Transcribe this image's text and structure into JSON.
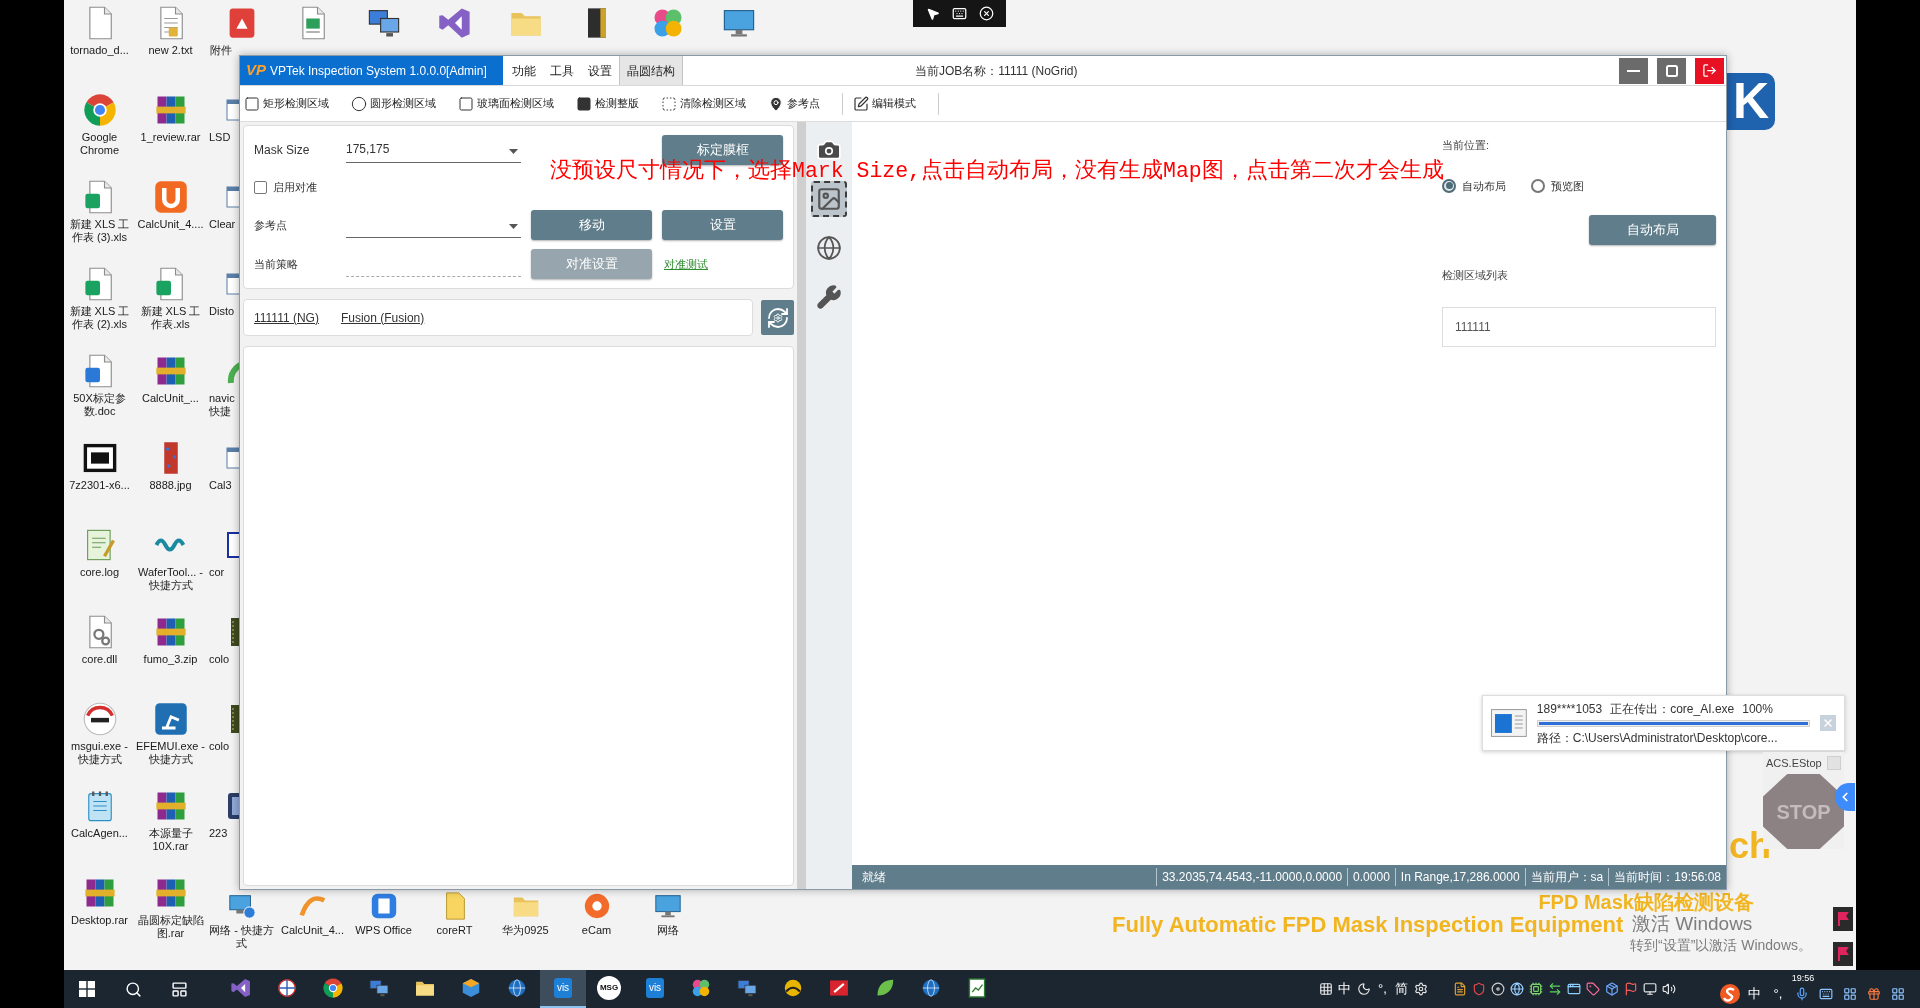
{
  "desktop": {
    "columns": [
      [
        {
          "label": "tornado_d...",
          "kind": "blank"
        },
        {
          "label": "Google Chrome",
          "kind": "browser"
        },
        {
          "label": "新建 XLS 工作表 (3).xls",
          "kind": "sheet"
        },
        {
          "label": "新建 XLS 工作表 (2).xls",
          "kind": "sheet"
        },
        {
          "label": "50X标定参数.doc",
          "kind": "word"
        },
        {
          "label": "7z2301-x6...",
          "kind": "box"
        },
        {
          "label": "core.log",
          "kind": "log"
        },
        {
          "label": "core.dll",
          "kind": "dll"
        },
        {
          "label": "msgui.exe - 快捷方式",
          "kind": "msg"
        },
        {
          "label": "CalcAgen...",
          "kind": "notepad"
        },
        {
          "label": "Desktop.rar",
          "kind": "rar"
        }
      ],
      [
        {
          "label": "new 2.txt",
          "kind": "txt"
        },
        {
          "label": "1_review.rar",
          "kind": "rar"
        },
        {
          "label": "CalcUnit_4....",
          "kind": "ulogo"
        },
        {
          "label": "新建 XLS 工作表.xls",
          "kind": "sheet"
        },
        {
          "label": "CalcUnit_...",
          "kind": "rar"
        },
        {
          "label": "8888.jpg",
          "kind": "image"
        },
        {
          "label": "WaferTool... - 快捷方式",
          "kind": "wave"
        },
        {
          "label": "fumo_3.zip",
          "kind": "rar"
        },
        {
          "label": "EFEMUI.exe - 快捷方式",
          "kind": "robot"
        },
        {
          "label": "本源量子 10X.rar",
          "kind": "rar"
        },
        {
          "label": "晶圆标定缺陷图.rar",
          "kind": "rar"
        }
      ]
    ],
    "top_row": [
      {
        "label": "附件",
        "kind": "pdf"
      },
      {
        "kind": "exe"
      },
      {
        "kind": "computers"
      },
      {
        "kind": "ribbon"
      },
      {
        "kind": "folder"
      },
      {
        "kind": "binder"
      },
      {
        "kind": "petals"
      },
      {
        "kind": "monitor"
      }
    ],
    "partial_column": [
      {
        "label": "LSD",
        "kind": "window"
      },
      {
        "label": "Clear",
        "kind": "window"
      },
      {
        "label": "Disto",
        "kind": "window"
      },
      {
        "label": "navic 快捷",
        "kind": "arc"
      },
      {
        "label": "Cal3",
        "kind": "window"
      },
      {
        "label": "cor",
        "kind": "frame"
      },
      {
        "label": "colo",
        "kind": "film"
      },
      {
        "label": "colo",
        "kind": "film"
      },
      {
        "label": "223",
        "kind": "tablet"
      }
    ],
    "bottom_row": [
      {
        "label": "网络 - 快捷方式",
        "kind": "network"
      },
      {
        "label": "CalcUnit_4...",
        "kind": "swoosh"
      },
      {
        "label": "WPS Office",
        "kind": "wps"
      },
      {
        "label": "coreRT",
        "kind": "file"
      },
      {
        "label": "华为0925",
        "kind": "folder"
      },
      {
        "label": "eCam",
        "kind": "camapp"
      },
      {
        "label": "网络",
        "kind": "monitor"
      }
    ]
  },
  "window": {
    "logo": "VP",
    "title": "VPTek Inspection System 1.0.0.0[Admin]",
    "menu": [
      {
        "label": "功能",
        "selected": false
      },
      {
        "label": "工具",
        "selected": false
      },
      {
        "label": "设置",
        "selected": false
      },
      {
        "label": "晶圆结构",
        "selected": true
      }
    ],
    "job": "当前JOB名称：11111 (NoGrid)"
  },
  "toolbar": [
    {
      "label": "矩形检测区域",
      "kind": "rect"
    },
    {
      "label": "圆形检测区域",
      "kind": "circle"
    },
    {
      "label": "玻璃面检测区域",
      "kind": "glass"
    },
    {
      "label": "检测整版",
      "kind": "full"
    },
    {
      "label": "清除检测区域",
      "kind": "clear"
    },
    {
      "label": "参考点",
      "kind": "pin"
    },
    {
      "label": "编辑模式",
      "kind": "edit"
    }
  ],
  "left_panel": {
    "mask_size": {
      "label": "Mask Size",
      "value": "175,175"
    },
    "calibrate_button": "标定膜框",
    "align": {
      "label": "启用对准",
      "checked": false
    },
    "reference": {
      "label": "参考点"
    },
    "move_button": "移动",
    "set_button": "设置",
    "strategy": {
      "label": "当前策略"
    },
    "align_settings_button": {
      "label": "对准设置",
      "disabled": true
    },
    "align_test_link": "对准测试",
    "job_links": [
      "111111 (NG)",
      "Fusion (Fusion)"
    ]
  },
  "side_tools": [
    {
      "kind": "camera",
      "selected": false
    },
    {
      "kind": "image",
      "selected": true
    },
    {
      "kind": "globe",
      "selected": false
    },
    {
      "kind": "tools",
      "selected": false
    }
  ],
  "right_panel": {
    "position_label": "当前位置:",
    "modes": [
      {
        "label": "自动布局",
        "selected": true
      },
      {
        "label": "预览图",
        "selected": false
      }
    ],
    "auto_layout_button": "自动布局",
    "list_label": "检测区域列表",
    "list_items": [
      "111111"
    ]
  },
  "status_bar": {
    "state": "就绪",
    "fields": [
      "33.2035,74.4543,-11.0000,0.0000",
      "0.0000",
      "In Range,17,286.0000",
      "当前用户：sa",
      "当前时间：19:56:08"
    ]
  },
  "annotation": [
    {
      "text": "没预设尺寸情况下，选择",
      "kind": "cjk"
    },
    {
      "text": "Mark Size,",
      "kind": "latin"
    },
    {
      "text": "点击自动布局，没有生成",
      "kind": "cjk"
    },
    {
      "text": "Map",
      "kind": "latin"
    },
    {
      "text": "图，点击第二次才会生成",
      "kind": "cjk"
    }
  ],
  "wallpaper": {
    "logo": "K",
    "fragment": "ch",
    "title_cn": "FPD Mask缺陷检测设备",
    "title_en": "Fully Automatic FPD Mask Inspection Equipment"
  },
  "activation": {
    "title": "激活 Windows",
    "hint": "转到“设置”以激活 Windows。"
  },
  "transfer_popup": {
    "sender": "189****1053",
    "status": "正在传出：core_AI.exe",
    "percent": "100%",
    "level": 1,
    "path": "路径：C:\\Users\\Administrator\\Desktop\\core..."
  },
  "estop": {
    "title": "ACS.EStop",
    "sign": "STOP"
  },
  "taskbar": {
    "apps": [
      {
        "kind": "ribbon",
        "selected": false
      },
      {
        "kind": "wheel",
        "selected": false
      },
      {
        "kind": "browser",
        "selected": false
      },
      {
        "kind": "computers",
        "selected": false
      },
      {
        "kind": "folder",
        "selected": false
      },
      {
        "kind": "cube",
        "selected": false
      },
      {
        "kind": "globeapp",
        "selected": false
      },
      {
        "kind": "badge",
        "label": "vis",
        "selected": true
      },
      {
        "kind": "roundbadge",
        "label": "MSG",
        "selected": false
      },
      {
        "kind": "badge",
        "label": "vis",
        "selected": false
      },
      {
        "kind": "petals",
        "selected": false
      },
      {
        "kind": "computers",
        "selected": false
      },
      {
        "kind": "ball",
        "selected": false
      },
      {
        "kind": "redapp",
        "selected": false
      },
      {
        "kind": "leaf",
        "selected": false
      },
      {
        "kind": "globeapp",
        "selected": false
      },
      {
        "kind": "chart",
        "selected": false
      }
    ],
    "ime": [
      {
        "kind": "grid"
      },
      {
        "kind": "text",
        "label": "中"
      },
      {
        "kind": "moon"
      },
      {
        "kind": "text",
        "label": "°,"
      },
      {
        "kind": "text",
        "label": "简"
      },
      {
        "kind": "gear"
      }
    ],
    "tray": [
      {
        "kind": "file"
      },
      {
        "kind": "shield"
      },
      {
        "kind": "disc"
      },
      {
        "kind": "globe"
      },
      {
        "kind": "chip"
      },
      {
        "kind": "arrows"
      },
      {
        "kind": "window"
      },
      {
        "kind": "tag"
      },
      {
        "kind": "package"
      },
      {
        "kind": "flag"
      },
      {
        "kind": "monitor"
      },
      {
        "kind": "speaker"
      }
    ],
    "ime2": [
      {
        "kind": "swirl"
      },
      {
        "kind": "text",
        "label": "中"
      },
      {
        "kind": "text",
        "label": "°,"
      },
      {
        "kind": "mic"
      },
      {
        "kind": "keyboard"
      },
      {
        "kind": "apps"
      },
      {
        "kind": "gift"
      },
      {
        "kind": "apps"
      }
    ],
    "clock": "19:56"
  }
}
